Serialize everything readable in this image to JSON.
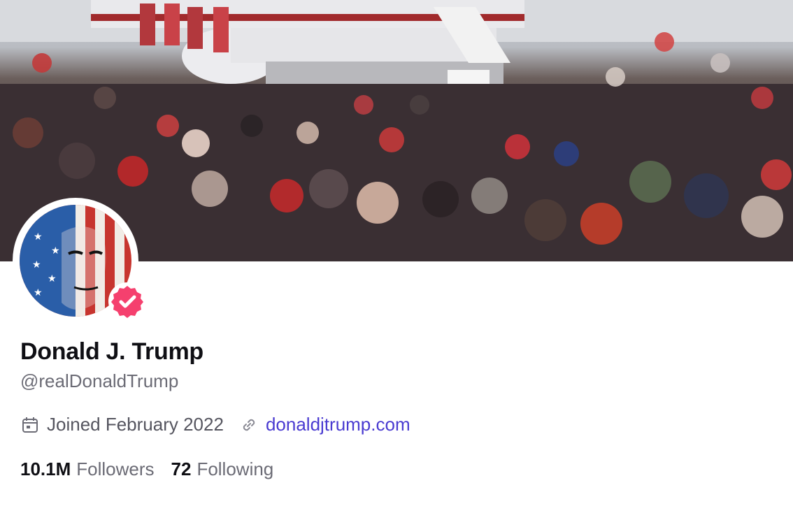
{
  "profile": {
    "name": "Donald J. Trump",
    "handle": "@realDonaldTrump",
    "joined": "Joined February 2022",
    "website": "donaldjtrump.com",
    "verified": true
  },
  "stats": {
    "followers_count": "10.1M",
    "followers_label": "Followers",
    "following_count": "72",
    "following_label": "Following"
  },
  "colors": {
    "link": "#4a3bd1",
    "verified_badge": "#f5406e"
  },
  "icons": {
    "joined": "calendar-icon",
    "website": "link-icon",
    "verified": "verified-badge-icon"
  }
}
